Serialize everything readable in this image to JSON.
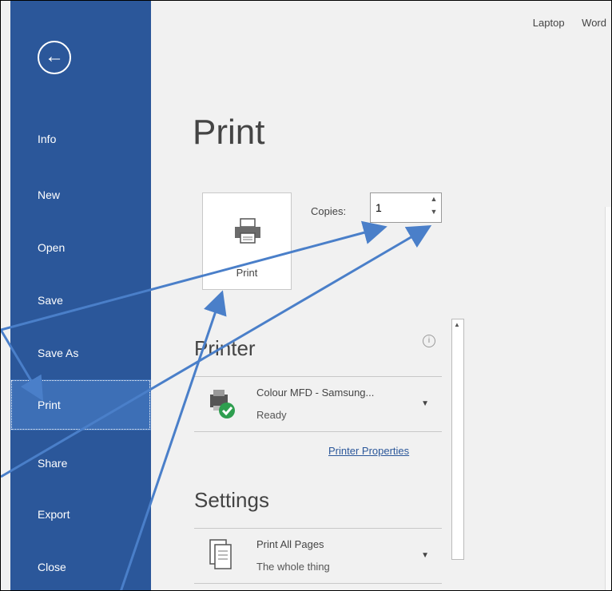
{
  "titlebar": {
    "items": [
      "Laptop",
      "Word"
    ]
  },
  "sidebar": {
    "back_icon": "back-arrow-icon",
    "items": [
      {
        "label": "Info"
      },
      {
        "label": "New"
      },
      {
        "label": "Open"
      },
      {
        "label": "Save"
      },
      {
        "label": "Save As"
      },
      {
        "label": "Print",
        "active": true
      },
      {
        "label": "Share"
      },
      {
        "label": "Export"
      },
      {
        "label": "Close"
      }
    ]
  },
  "main": {
    "title": "Print",
    "print_button": {
      "label": "Print",
      "icon": "printer-icon"
    },
    "copies": {
      "label": "Copies:",
      "value": "1"
    },
    "printer": {
      "section_title": "Printer",
      "name": "Colour MFD - Samsung...",
      "status": "Ready",
      "properties_link": "Printer Properties"
    },
    "settings": {
      "section_title": "Settings",
      "range": "Print All Pages",
      "range_desc": "The whole thing"
    }
  },
  "colors": {
    "sidebar": "#2b579a",
    "active": "#3d6fb6",
    "annotation_arrow": "#4a7fc9"
  }
}
